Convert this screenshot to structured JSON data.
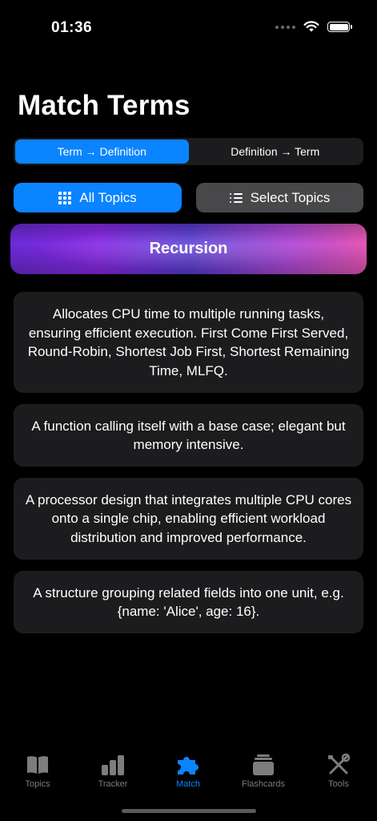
{
  "status_bar": {
    "time": "01:36"
  },
  "title": "Match Terms",
  "mode_segmented": {
    "options": [
      "Term → Definition",
      "Definition → Term"
    ],
    "selected": "Term → Definition"
  },
  "topic_buttons": {
    "all_topics": "All Topics",
    "select_topics": "Select Topics"
  },
  "term": "Recursion",
  "definitions": [
    "Allocates CPU time to multiple running tasks, ensuring efficient execution. First Come First Served, Round-Robin, Shortest Job First, Shortest Remaining Time, MLFQ.",
    "A function calling itself with a base case; elegant but memory intensive.",
    "A processor design that integrates multiple CPU cores onto a single chip, enabling efficient workload distribution and improved performance.",
    "A structure grouping related fields into one unit, e.g. {name: 'Alice', age: 16}."
  ],
  "tab_bar": {
    "items": [
      {
        "label": "Topics",
        "icon": "book-icon"
      },
      {
        "label": "Tracker",
        "icon": "bar-chart-icon"
      },
      {
        "label": "Match",
        "icon": "puzzle-icon"
      },
      {
        "label": "Flashcards",
        "icon": "cards-stack-icon"
      },
      {
        "label": "Tools",
        "icon": "tools-icon"
      }
    ],
    "selected": "Match"
  },
  "colors": {
    "accent": "#0a84ff",
    "card_background": "#1c1c1e",
    "secondary_button": "#48484a",
    "inactive_tab": "#7d7d7f"
  }
}
